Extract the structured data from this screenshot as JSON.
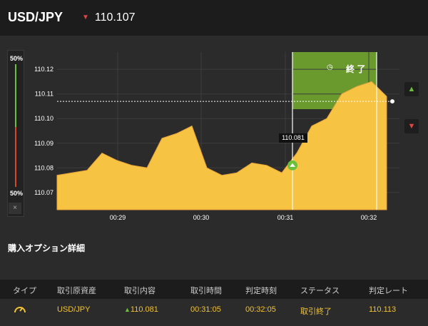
{
  "header": {
    "pair": "USD/JPY",
    "rate": "110.107",
    "direction_icon": "down-arrow-icon"
  },
  "gauge": {
    "top_pct": "50%",
    "bottom_pct": "50%",
    "close": "×"
  },
  "chart": {
    "y_ticks": [
      "110.12",
      "110.11",
      "110.10",
      "110.09",
      "110.08",
      "110.07"
    ],
    "x_ticks": [
      "00:29",
      "00:30",
      "00:31",
      "00:32"
    ],
    "current_rate": "110.107",
    "entry_label": "110.081",
    "end_label": "終 了",
    "colors": {
      "area": "#f6c343",
      "window": "#6a9a2e",
      "up": "#6cbf3a",
      "down": "#e04545"
    }
  },
  "chart_data": {
    "type": "area",
    "x": [
      "00:28:40",
      "00:28:50",
      "00:29:00",
      "00:29:10",
      "00:29:20",
      "00:29:30",
      "00:29:40",
      "00:29:50",
      "00:30:00",
      "00:30:10",
      "00:30:20",
      "00:30:30",
      "00:30:40",
      "00:30:50",
      "00:31:00",
      "00:31:10",
      "00:31:20",
      "00:31:30",
      "00:31:40",
      "00:31:50",
      "00:32:00",
      "00:32:10",
      "00:32:20"
    ],
    "values": [
      110.077,
      110.078,
      110.079,
      110.086,
      110.083,
      110.081,
      110.08,
      110.092,
      110.094,
      110.097,
      110.08,
      110.077,
      110.078,
      110.082,
      110.081,
      110.078,
      110.086,
      110.097,
      110.1,
      110.11,
      110.113,
      110.115,
      110.109
    ],
    "ylim": [
      110.063,
      110.127
    ],
    "grid": true
  },
  "details": {
    "title": "購入オプション詳細",
    "headers": [
      "タイプ",
      "取引原資産",
      "取引内容",
      "取引時間",
      "判定時刻",
      "ステータス",
      "判定レート"
    ],
    "row": {
      "asset": "USD/JPY",
      "content": "110.081",
      "trade_time": "00:31:05",
      "judge_time": "00:32:05",
      "status": "取引終了",
      "rate": "110.113"
    }
  }
}
